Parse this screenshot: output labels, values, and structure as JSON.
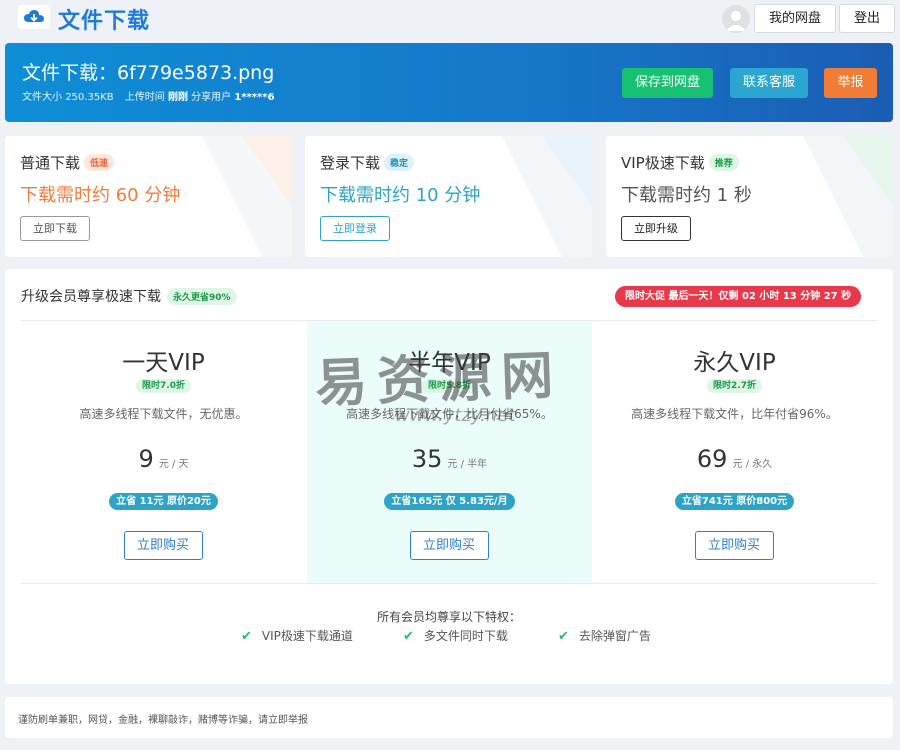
{
  "header": {
    "logo_icon": "cloud-download-icon",
    "title": "文件下载",
    "avatar_icon": "user-avatar-icon",
    "my_drive_label": "我的网盘",
    "logout_label": "登出"
  },
  "file": {
    "title": "文件下载：6f779e5873.png",
    "size_label": "文件大小",
    "size_value": "250.35KB",
    "upload_label": "上传时间",
    "upload_value": "刚刚",
    "sharer_label": "分享用户",
    "sharer_value": "1*****6"
  },
  "banner_buttons": {
    "save": "保存到网盘",
    "contact": "联系客服",
    "report": "举报",
    "save_color": "#16c172",
    "contact_color": "#2ba6d0",
    "report_color": "#f07c35"
  },
  "download_options": [
    {
      "title": "普通下载",
      "tag": "低速",
      "time": "下载需时约 60 分钟",
      "button": "立即下载"
    },
    {
      "title": "登录下载",
      "tag": "稳定",
      "time": "下载需时约 10 分钟",
      "button": "立即登录"
    },
    {
      "title": "VIP极速下载",
      "tag": "推荐",
      "time": "下载需时约 1 秒",
      "button": "立即升级"
    }
  ],
  "vip": {
    "title": "升级会员尊享极速下载",
    "title_tag": "永久更省90%",
    "promo": "限时大促 最后一天！仅剩 02 小时 13 分钟 27 秒",
    "plans": [
      {
        "name": "一天VIP",
        "discount": "限时7.0折",
        "desc": "高速多线程下载文件，无优惠。",
        "price": "9",
        "unit": "元 / 天",
        "save": "立省 11元 原价20元",
        "buy": "立即购买"
      },
      {
        "name": "半年VIP",
        "discount": "限时5.8折",
        "desc": "高速多线程下载文件，比月付省65%。",
        "price": "35",
        "unit": "元 / 半年",
        "save": "立省165元 仅 5.83元/月",
        "buy": "立即购买"
      },
      {
        "name": "永久VIP",
        "discount": "限时2.7折",
        "desc": "高速多线程下载文件，比年付省96%。",
        "price": "69",
        "unit": "元 / 永久",
        "save": "立省741元 原价800元",
        "buy": "立即购买"
      }
    ],
    "privileges_title": "所有会员均尊享以下特权：",
    "privileges": [
      "VIP极速下载通道",
      "多文件同时下载",
      "去除弹窗广告"
    ]
  },
  "watermark": {
    "text": "易资源网",
    "url": "www.ytzy.net"
  },
  "footer": {
    "notice": "谨防刷单兼职，网贷，金融，裸聊敲诈，赌博等诈骗，请立即举报"
  }
}
